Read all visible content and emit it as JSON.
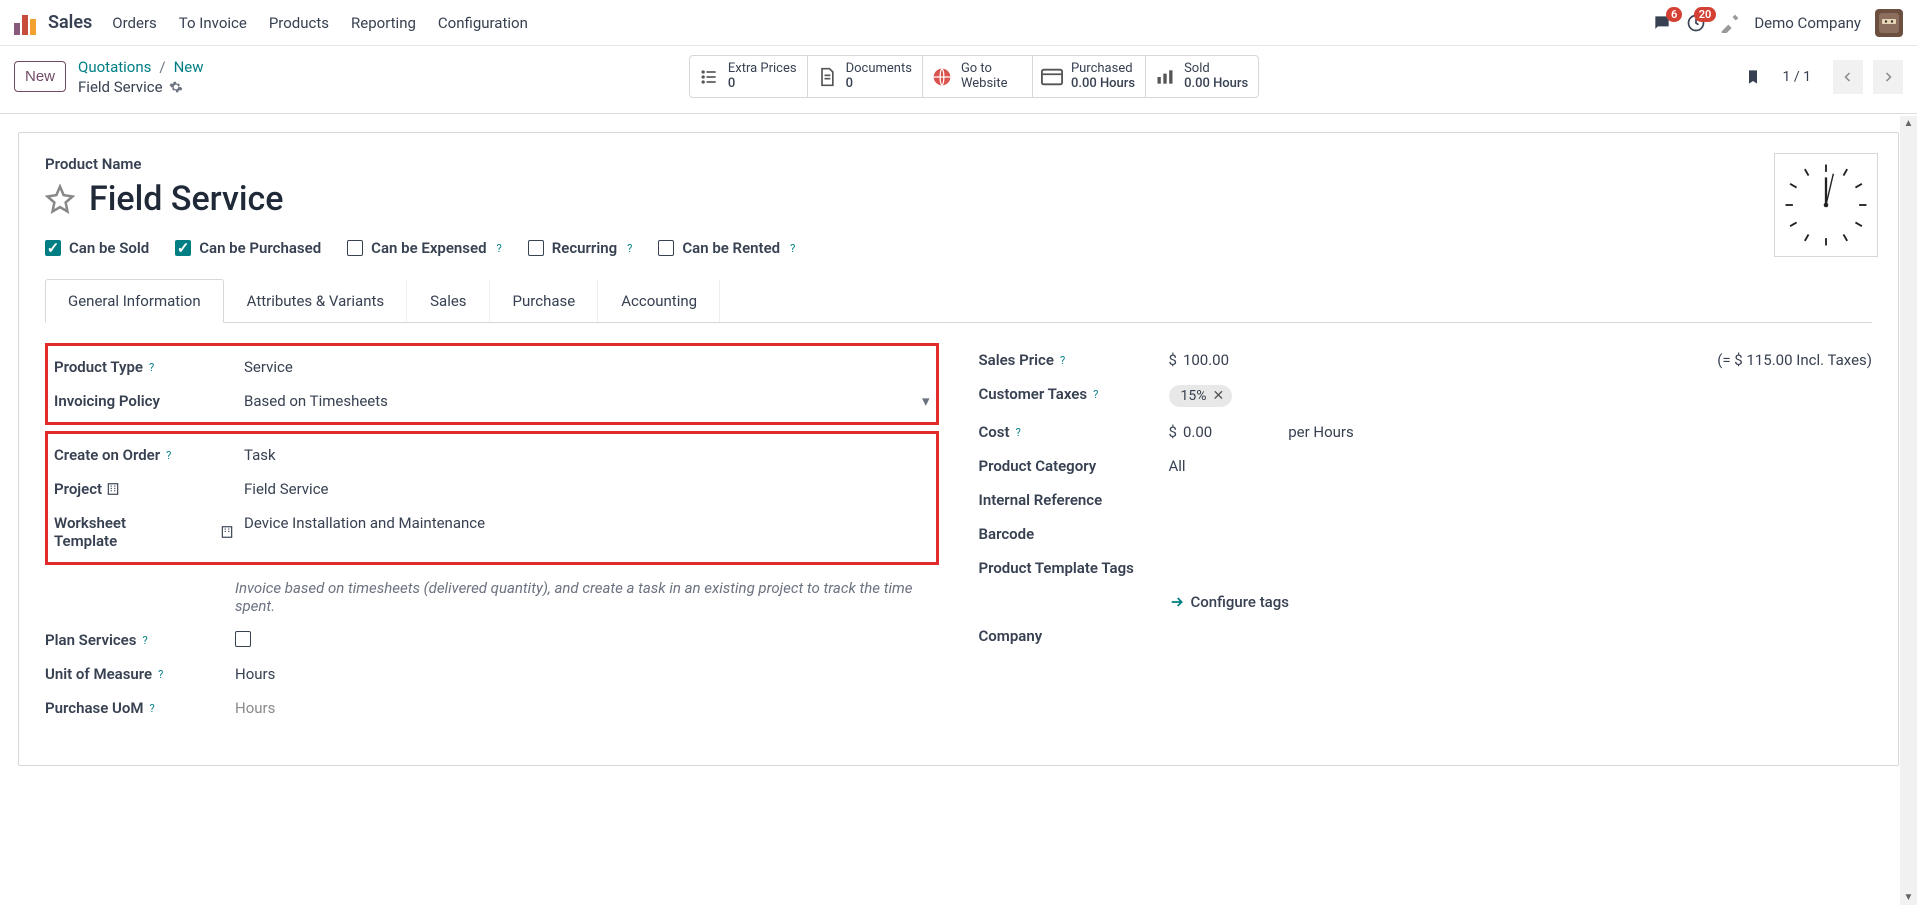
{
  "app": {
    "title": "Sales"
  },
  "nav": [
    "Orders",
    "To Invoice",
    "Products",
    "Reporting",
    "Configuration"
  ],
  "topRight": {
    "msgBadge": "6",
    "clockBadge": "20",
    "company": "Demo Company"
  },
  "subbar": {
    "newBtn": "New",
    "crumb1": "Quotations",
    "crumb2": "New",
    "crumbSub": "Field Service"
  },
  "statboxes": [
    {
      "label": "Extra Prices",
      "value": "0"
    },
    {
      "label": "Documents",
      "value": "0"
    },
    {
      "label": "Go to",
      "label2": "Website"
    },
    {
      "label": "Purchased",
      "value": "0.00 Hours"
    },
    {
      "label": "Sold",
      "value": "0.00 Hours"
    }
  ],
  "pager": {
    "text": "1 / 1"
  },
  "form": {
    "productNameLabel": "Product Name",
    "title": "Field Service",
    "checks": {
      "sold": "Can be Sold",
      "purchased": "Can be Purchased",
      "expensed": "Can be Expensed",
      "recurring": "Recurring",
      "rented": "Can be Rented"
    },
    "tabs": [
      "General Information",
      "Attributes & Variants",
      "Sales",
      "Purchase",
      "Accounting"
    ],
    "left": {
      "productTypeLabel": "Product Type",
      "productType": "Service",
      "invoicingPolicyLabel": "Invoicing Policy",
      "invoicingPolicy": "Based on Timesheets",
      "createOnOrderLabel": "Create on Order",
      "createOnOrder": "Task",
      "projectLabel": "Project",
      "project": "Field Service",
      "worksheetLabel": "Worksheet Template",
      "worksheet": "Device Installation and Maintenance",
      "helpText": "Invoice based on timesheets (delivered quantity), and create a task in an existing project to track the time spent.",
      "planServicesLabel": "Plan Services",
      "uomLabel": "Unit of Measure",
      "uom": "Hours",
      "puomLabel": "Purchase UoM",
      "puom": "Hours"
    },
    "right": {
      "salesPriceLabel": "Sales Price",
      "salesPriceCur": "$",
      "salesPrice": "100.00",
      "salesPriceIncl": "(= $ 115.00 Incl. Taxes)",
      "custTaxLabel": "Customer Taxes",
      "custTax": "15%",
      "costLabel": "Cost",
      "costCur": "$",
      "cost": "0.00",
      "costUnit": "per Hours",
      "categoryLabel": "Product Category",
      "category": "All",
      "intRefLabel": "Internal Reference",
      "barcodeLabel": "Barcode",
      "tagsLabel": "Product Template Tags",
      "configureTags": "Configure tags",
      "companyLabel": "Company"
    }
  }
}
